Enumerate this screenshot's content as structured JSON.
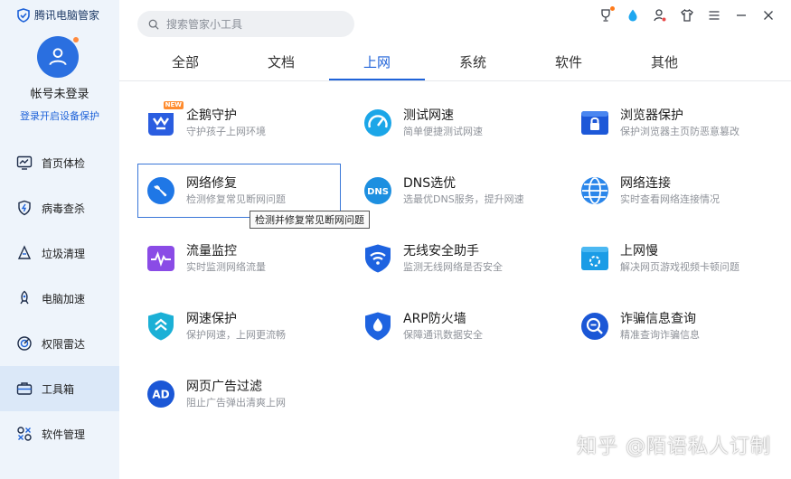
{
  "app": {
    "title": "腾讯电脑管家"
  },
  "account": {
    "username": "帐号未登录",
    "login_link": "登录开启设备保护"
  },
  "nav": [
    {
      "label": "首页体检",
      "icon": "chart-icon"
    },
    {
      "label": "病毒查杀",
      "icon": "shield-bolt-icon"
    },
    {
      "label": "垃圾清理",
      "icon": "broom-icon"
    },
    {
      "label": "电脑加速",
      "icon": "rocket-icon"
    },
    {
      "label": "权限雷达",
      "icon": "radar-icon"
    },
    {
      "label": "工具箱",
      "icon": "toolbox-icon",
      "active": true
    },
    {
      "label": "软件管理",
      "icon": "apps-icon"
    }
  ],
  "search": {
    "placeholder": "搜索管家小工具"
  },
  "tabs": [
    "全部",
    "文档",
    "上网",
    "系统",
    "软件",
    "其他"
  ],
  "active_tab": "上网",
  "tools": [
    {
      "name": "企鹅守护",
      "desc": "守护孩子上网环境",
      "icon": "penguin-guard-icon",
      "badge": "NEW"
    },
    {
      "name": "测试网速",
      "desc": "简单便捷测试网速",
      "icon": "speedometer-icon"
    },
    {
      "name": "浏览器保护",
      "desc": "保护浏览器主页防恶意篡改",
      "icon": "browser-lock-icon"
    },
    {
      "name": "网络修复",
      "desc": "检测修复常见断网问题",
      "icon": "wrench-globe-icon"
    },
    {
      "name": "DNS选优",
      "desc": "选最优DNS服务，提升网速",
      "icon": "dns-icon"
    },
    {
      "name": "网络连接",
      "desc": "实时查看网络连接情况",
      "icon": "globe-icon"
    },
    {
      "name": "流量监控",
      "desc": "实时监测网络流量",
      "icon": "traffic-monitor-icon"
    },
    {
      "name": "无线安全助手",
      "desc": "监测无线网络是否安全",
      "icon": "wifi-shield-icon"
    },
    {
      "name": "上网慢",
      "desc": "解决网页游戏视频卡顿问题",
      "icon": "slow-loading-icon"
    },
    {
      "name": "网速保护",
      "desc": "保护网速，上网更流畅",
      "icon": "speed-shield-icon"
    },
    {
      "name": "ARP防火墙",
      "desc": "保障通讯数据安全",
      "icon": "firewall-drop-icon"
    },
    {
      "name": "诈骗信息查询",
      "desc": "精准查询诈骗信息",
      "icon": "fraud-search-icon"
    },
    {
      "name": "网页广告过滤",
      "desc": "阻止广告弹出清爽上网",
      "icon": "ad-filter-icon"
    }
  ],
  "tooltip": "检测并修复常见断网问题",
  "watermark": "知乎 @陌语私人订制",
  "colors": {
    "accent": "#1f63d9",
    "sidebar_bg": "#eef4fb",
    "sidebar_active": "#dbe8f8"
  }
}
